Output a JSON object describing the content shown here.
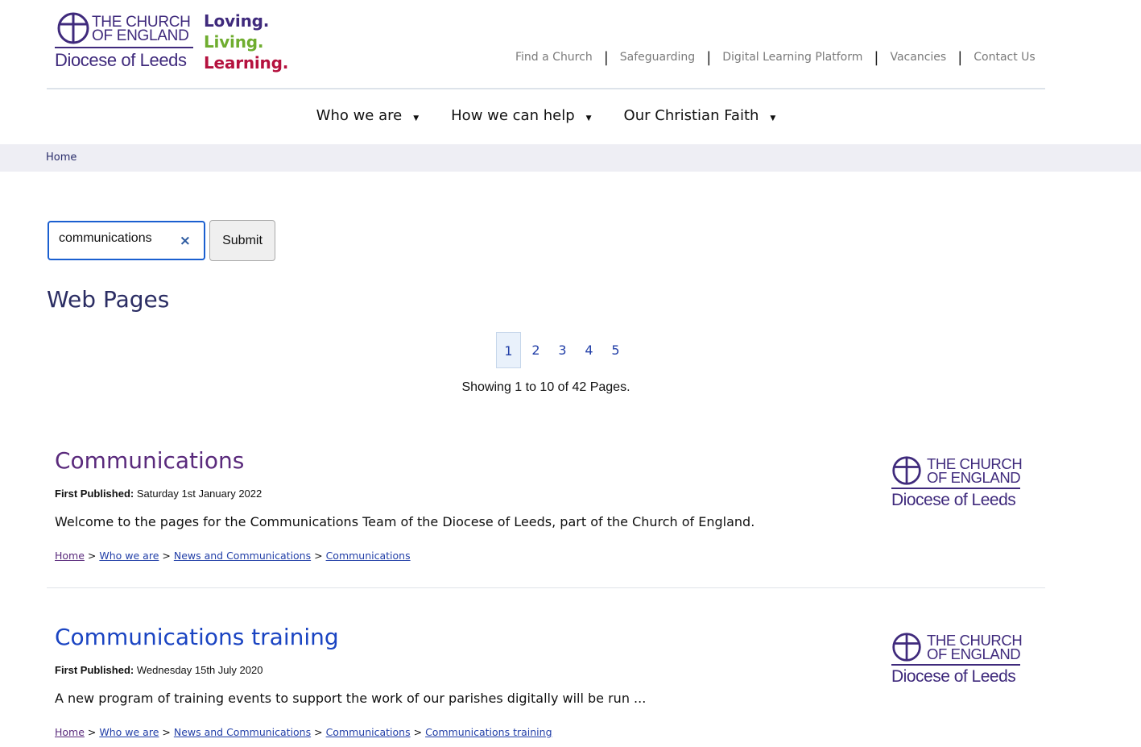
{
  "logo": {
    "line1": "THE CHURCH",
    "line2": "OF ENGLAND",
    "line3": "Diocese of Leeds",
    "tagline": [
      "Loving.",
      "Living.",
      "Learning."
    ],
    "colors": {
      "purple": "#3f2a7c",
      "green": "#6fad2f",
      "red": "#b5123f"
    }
  },
  "topnav": {
    "items": [
      "Find a Church",
      "Safeguarding",
      "Digital Learning Platform",
      "Vacancies",
      "Contact Us"
    ],
    "separator": "|"
  },
  "mainnav": {
    "items": [
      "Who we are",
      "How we can help",
      "Our Christian Faith"
    ],
    "caret": "▼"
  },
  "breadcrumb": {
    "home": "Home"
  },
  "search": {
    "value": "communications",
    "clear_icon": "×",
    "submit_label": "Submit"
  },
  "section_title": "Web Pages",
  "pagination": {
    "pages": [
      "1",
      "2",
      "3",
      "4",
      "5"
    ],
    "current": "1",
    "showing": "Showing 1 to 10 of 42 Pages."
  },
  "results": [
    {
      "title": "Communications",
      "title_color": "#5a2a7c",
      "published_label": "First Published:",
      "published_date": "Saturday 1st January 2022",
      "description": "Welcome to the pages for the Communications Team of the Diocese of Leeds, part of the Church of England.",
      "trail": [
        "Home",
        "Who we are",
        "News and Communications",
        "Communications"
      ],
      "trail_sep": ">"
    },
    {
      "title": "Communications training",
      "title_color": "#1a44c2",
      "published_label": "First Published:",
      "published_date": "Wednesday 15th July 2020",
      "description": "A new program of training events to support the work of our parishes digitally will be run ...",
      "trail": [
        "Home",
        "Who we are",
        "News and Communications",
        "Communications",
        "Communications training"
      ],
      "trail_sep": ">"
    }
  ]
}
